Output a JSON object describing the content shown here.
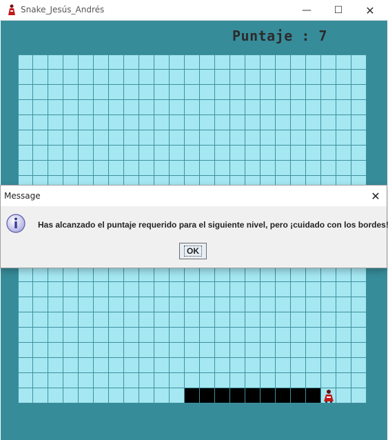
{
  "window": {
    "title": "Snake_Jesús_Andrés",
    "minimize_glyph": "—",
    "maximize_glyph": "☐",
    "close_glyph": "✕",
    "icon": "snake-charmer-icon"
  },
  "game": {
    "score_text": "Puntaje : 7",
    "score": 7,
    "grid": {
      "columns": 23,
      "rows": 23
    },
    "snake": {
      "body_row": 22,
      "body_columns": [
        11,
        12,
        13,
        14,
        15,
        16,
        17,
        18,
        19
      ],
      "head": {
        "row": 22,
        "column": 20,
        "icon": "character-icon"
      }
    },
    "colors": {
      "background": "#378c9a",
      "cell": "#a5e8f2",
      "grid_line": "#3e8f9c",
      "snake": "#000000",
      "score": "#2b2b2b"
    }
  },
  "dialog": {
    "title": "Message",
    "close_glyph": "✕",
    "icon": "info-icon",
    "message": "Has alcanzado el puntaje requerido para el siguiente nivel, pero ¡cuidado con los bordes!",
    "ok_label": "OK"
  }
}
